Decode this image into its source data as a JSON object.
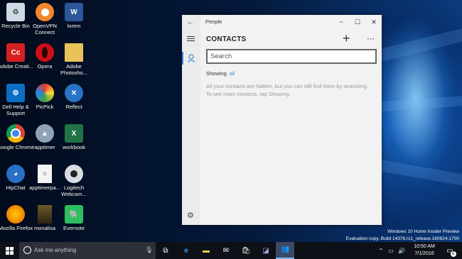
{
  "desktop": {
    "icons": [
      {
        "label": "Recycle Bin"
      },
      {
        "label": "OpenVPN Connect"
      },
      {
        "label": "lorem"
      },
      {
        "label": "Adobe Creati..."
      },
      {
        "label": "Opera"
      },
      {
        "label": "Adobe Photosho..."
      },
      {
        "label": "Dell Help & Support"
      },
      {
        "label": "PicPick"
      },
      {
        "label": "Reflect"
      },
      {
        "label": "Google Chrome"
      },
      {
        "label": "apptimer"
      },
      {
        "label": "workbook"
      },
      {
        "label": "HipChat"
      },
      {
        "label": "apptimerpa..."
      },
      {
        "label": "Logitech Webcam..."
      },
      {
        "label": "Mozilla Firefox"
      },
      {
        "label": "monalisa"
      },
      {
        "label": "Evernote"
      }
    ],
    "watermark_line1": "Windows 10 Home Insider Preview",
    "watermark_line2": "Evaluation copy. Build 14376.rs1_release.160624-1700"
  },
  "people_app": {
    "title": "People",
    "header": "CONTACTS",
    "search_placeholder": "Search",
    "showing_label": "Showing",
    "showing_link": "all",
    "message": "All your contacts are hidden, but you can still find them by searching. To see more contacts, tap Showing."
  },
  "taskbar": {
    "search_placeholder": "Ask me anything",
    "time": "10:50 AM",
    "date": "7/1/2016",
    "notification_count": "5"
  },
  "colors": {
    "accent": "#2f8be0",
    "taskbar": "#0e1017",
    "app_bg": "#f2f2f2"
  }
}
